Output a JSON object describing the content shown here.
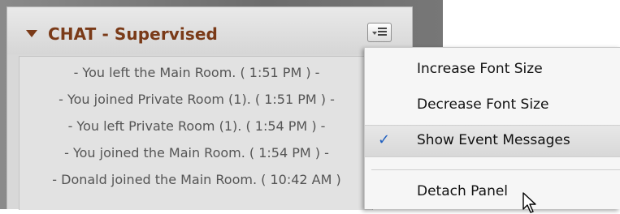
{
  "panel": {
    "title": "CHAT - Supervised",
    "menu_button_icon": "menu-list-icon",
    "collapse_icon": "triangle-down-icon"
  },
  "chat": {
    "messages": [
      "- You left the Main Room. ( 1:51 PM ) -",
      "- You joined Private Room (1). ( 1:51 PM ) -",
      "- You left Private Room (1). ( 1:54 PM ) -",
      "- You joined the Main Room. ( 1:54 PM ) -",
      "- Donald joined the Main Room. ( 10:42 AM )"
    ]
  },
  "context_menu": {
    "items": [
      {
        "label": "Increase Font Size",
        "checked": false
      },
      {
        "label": "Decrease Font Size",
        "checked": false
      },
      {
        "label": "Show Event Messages",
        "checked": true
      },
      {
        "label": "Detach Panel",
        "checked": false
      }
    ],
    "check_mark": "✓"
  },
  "colors": {
    "title": "#7a3a18",
    "check": "#2060c0"
  }
}
